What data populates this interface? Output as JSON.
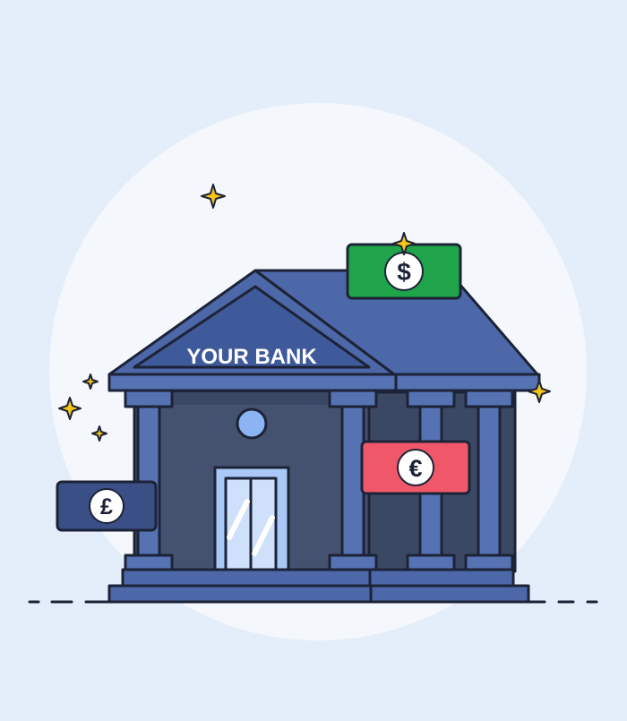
{
  "bank_sign": {
    "text": "YOUR BANK"
  },
  "notes": {
    "dollar": {
      "symbol": "$",
      "color": "#1fa44a"
    },
    "euro": {
      "symbol": "€",
      "color": "#f0586a"
    },
    "pound": {
      "symbol": "£",
      "color": "#3a4f86"
    }
  },
  "colors": {
    "background": "#e4eefa",
    "backdrop_circle": "#f4f8fd",
    "building_roof": "#4d68a8",
    "building_wall": "#44526f",
    "outline": "#1d2337",
    "sparkle": "#f5c518"
  },
  "icons": [
    "sparkle-icon",
    "dollar-icon",
    "euro-icon",
    "pound-icon"
  ]
}
